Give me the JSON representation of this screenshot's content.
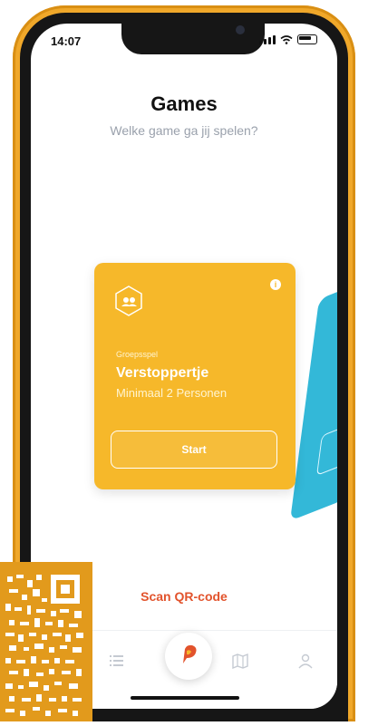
{
  "status_bar": {
    "time": "14:07"
  },
  "header": {
    "title": "Games",
    "subtitle": "Welke game ga jij spelen?"
  },
  "card": {
    "category": "Groepsspel",
    "name": "Verstoppertje",
    "players": "Minimaal 2 Personen",
    "start_label": "Start",
    "info_glyph": "i",
    "color": "#f6b82a"
  },
  "scan": {
    "label": "Scan QR-code"
  },
  "tabs": [
    {
      "icon": "list-icon"
    },
    {
      "icon": "app-logo-icon"
    },
    {
      "icon": "map-icon"
    },
    {
      "icon": "user-icon"
    }
  ],
  "colors": {
    "accent": "#e2532c",
    "frame": "#f0a82a",
    "card_secondary": "#33b8d8"
  }
}
